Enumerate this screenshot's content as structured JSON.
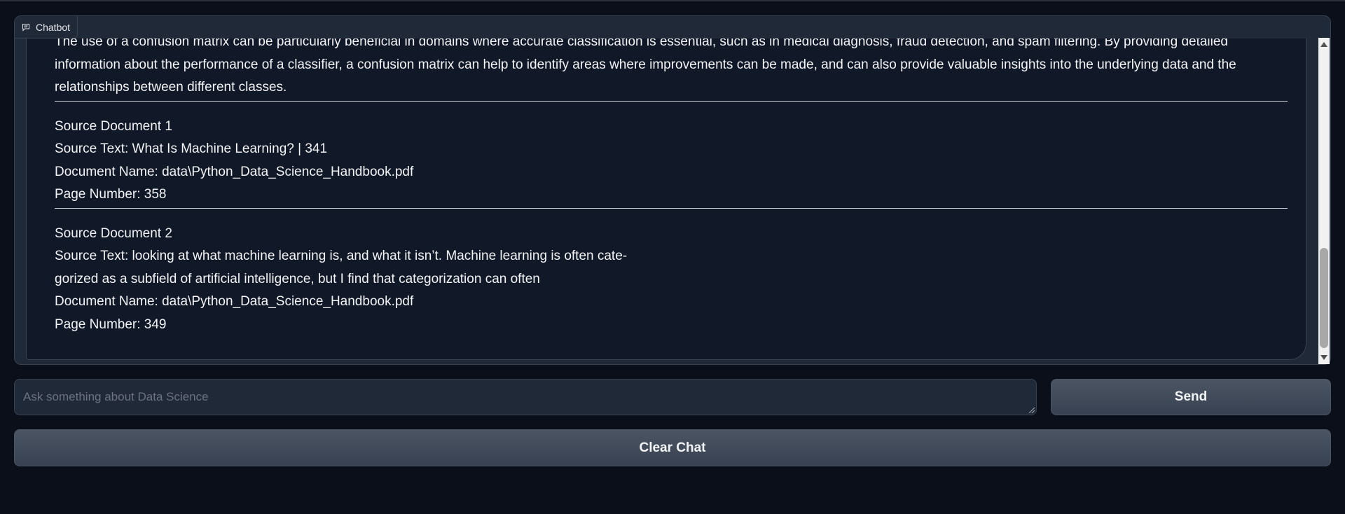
{
  "chatbot": {
    "label": "Chatbot",
    "label_icon": "chat-bubble-icon",
    "message": {
      "paragraph": "The use of a confusion matrix can be particularly beneficial in domains where accurate classification is essential, such as in medical diagnosis, fraud detection, and spam filtering. By providing detailed information about the performance of a classifier, a confusion matrix can help to identify areas where improvements can be made, and can also provide valuable insights into the underlying data and the relationships between different classes.",
      "sources": [
        {
          "title": "Source Document 1",
          "source_text_lines": [
            "Source Text: What Is Machine Learning? | 341"
          ],
          "document_name": "Document Name: data\\Python_Data_Science_Handbook.pdf",
          "page_number": "Page Number: 358"
        },
        {
          "title": "Source Document 2",
          "source_text_lines": [
            "Source Text: looking at what machine learning is, and what it isn’t. Machine learning is often cate-",
            "gorized as a subfield of artificial intelligence, but I find that categorization can often"
          ],
          "document_name": "Document Name: data\\Python_Data_Science_Handbook.pdf",
          "page_number": "Page Number: 349"
        }
      ]
    }
  },
  "input": {
    "placeholder": "Ask something about Data Science",
    "value": ""
  },
  "buttons": {
    "send": "Send",
    "clear": "Clear Chat"
  }
}
